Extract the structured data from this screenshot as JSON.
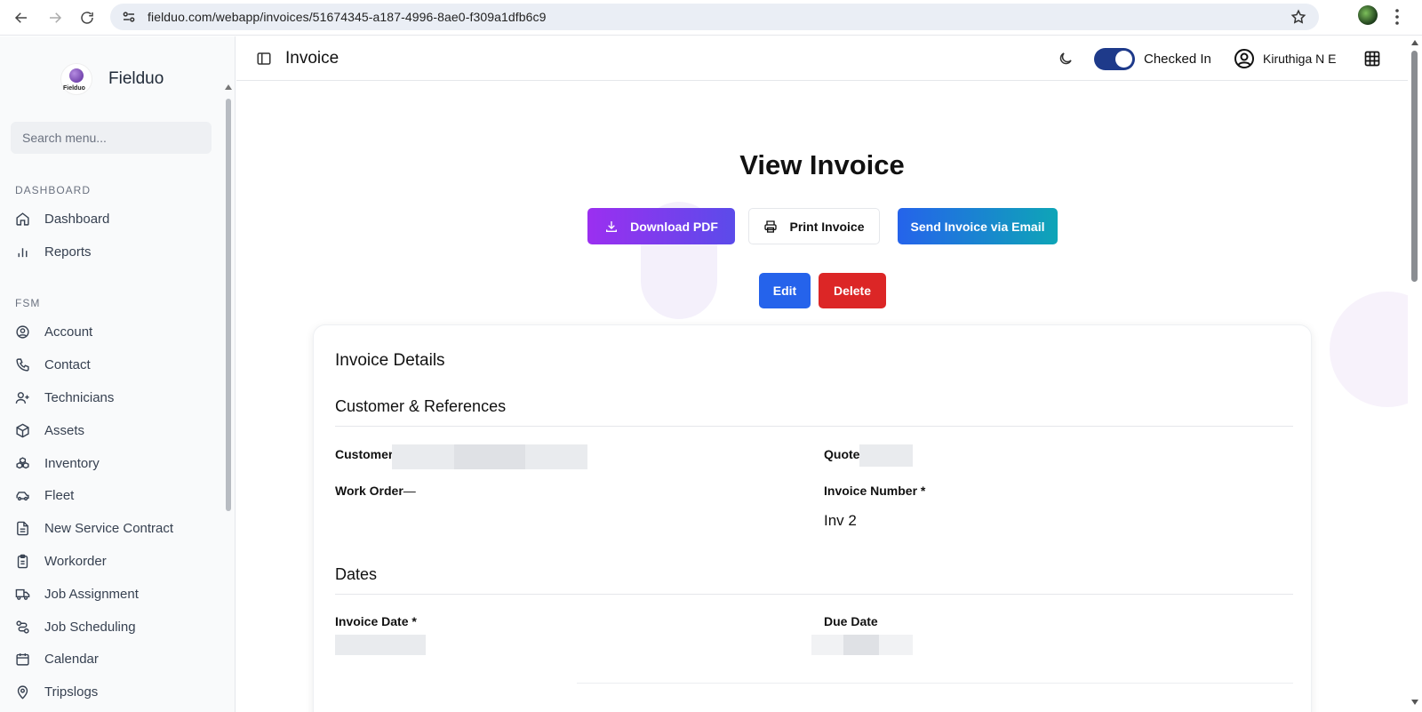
{
  "browser": {
    "url": "fielduo.com/webapp/invoices/51674345-a187-4996-8ae0-f309a1dfb6c9"
  },
  "sidebar": {
    "brand_name": "Fielduo",
    "brand_logo_text": "Fielduo",
    "search_placeholder": "Search menu...",
    "sections": [
      {
        "label": "DASHBOARD",
        "items": [
          {
            "label": "Dashboard",
            "icon": "home-icon"
          },
          {
            "label": "Reports",
            "icon": "bar-chart-icon"
          }
        ]
      },
      {
        "label": "FSM",
        "items": [
          {
            "label": "Account",
            "icon": "user-circle-icon"
          },
          {
            "label": "Contact",
            "icon": "phone-icon"
          },
          {
            "label": "Technicians",
            "icon": "user-plus-icon"
          },
          {
            "label": "Assets",
            "icon": "box-icon"
          },
          {
            "label": "Inventory",
            "icon": "boxes-icon"
          },
          {
            "label": "Fleet",
            "icon": "car-icon"
          },
          {
            "label": "New Service Contract",
            "icon": "file-text-icon"
          },
          {
            "label": "Workorder",
            "icon": "clipboard-icon"
          },
          {
            "label": "Job Assignment",
            "icon": "truck-icon"
          },
          {
            "label": "Job Scheduling",
            "icon": "route-icon"
          },
          {
            "label": "Calendar",
            "icon": "calendar-icon"
          },
          {
            "label": "Tripslogs",
            "icon": "map-pin-icon"
          }
        ]
      }
    ]
  },
  "topbar": {
    "title": "Invoice",
    "checked_in_label": "Checked In",
    "checked_in": true,
    "user_name": "Kiruthiga N E"
  },
  "main": {
    "page_title": "View Invoice",
    "buttons": {
      "download_pdf": "Download PDF",
      "print_invoice": "Print Invoice",
      "send_email": "Send Invoice via Email",
      "edit": "Edit",
      "delete": "Delete"
    },
    "card": {
      "title": "Invoice Details",
      "section_customer": "Customer & References",
      "customer_label": "Customer",
      "quote_label": "Quote",
      "work_order_label": "Work Order",
      "work_order_value": "—",
      "invoice_number_label": "Invoice Number *",
      "invoice_number_value": "Inv 2",
      "section_dates": "Dates",
      "invoice_date_label": "Invoice Date *",
      "due_date_label": "Due Date"
    }
  },
  "colors": {
    "toggle_on": "#1e3a8a",
    "download_gradient_start": "#9b2ff0",
    "download_gradient_end": "#5b4bea",
    "email_gradient_start": "#2563eb",
    "email_gradient_end": "#0ea5b7",
    "edit": "#2563eb",
    "delete": "#dc2626"
  }
}
